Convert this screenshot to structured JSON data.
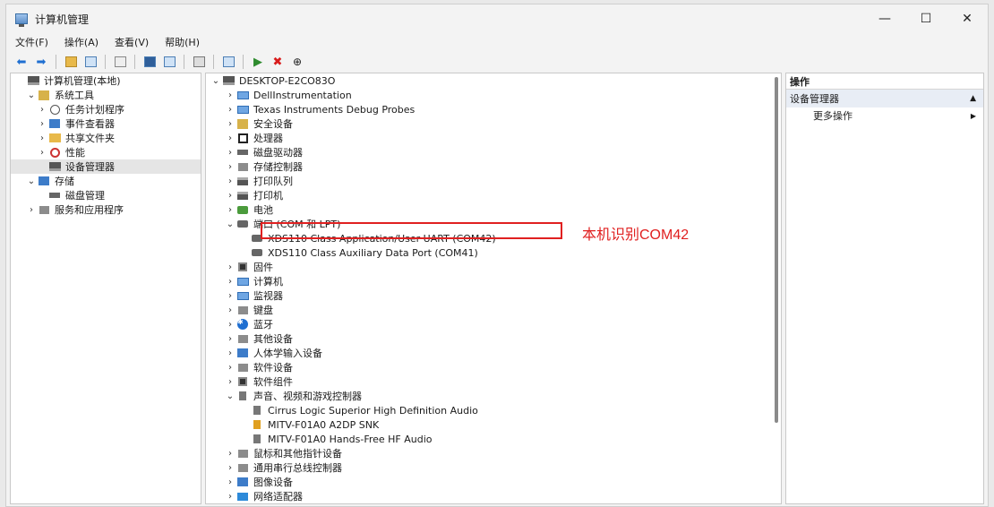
{
  "window": {
    "title": "计算机管理",
    "minimize": "—",
    "maximize": "☐",
    "close": "✕"
  },
  "menu": [
    "文件(F)",
    "操作(A)",
    "查看(V)",
    "帮助(H)"
  ],
  "left_tree": [
    {
      "label": "计算机管理(本地)",
      "indent": 0,
      "expander": "",
      "icon": "computer-mgmt-icon"
    },
    {
      "label": "系统工具",
      "indent": 1,
      "expander": "⌄",
      "icon": "tools-icon"
    },
    {
      "label": "任务计划程序",
      "indent": 2,
      "expander": "›",
      "icon": "clock-icon"
    },
    {
      "label": "事件查看器",
      "indent": 2,
      "expander": "›",
      "icon": "event-viewer-icon"
    },
    {
      "label": "共享文件夹",
      "indent": 2,
      "expander": "›",
      "icon": "shared-folder-icon"
    },
    {
      "label": "性能",
      "indent": 2,
      "expander": "›",
      "icon": "performance-icon"
    },
    {
      "label": "设备管理器",
      "indent": 2,
      "expander": "",
      "icon": "device-manager-icon",
      "selected": true
    },
    {
      "label": "存储",
      "indent": 1,
      "expander": "⌄",
      "icon": "storage-icon"
    },
    {
      "label": "磁盘管理",
      "indent": 2,
      "expander": "",
      "icon": "disk-mgmt-icon"
    },
    {
      "label": "服务和应用程序",
      "indent": 1,
      "expander": "›",
      "icon": "services-icon"
    }
  ],
  "device_tree": [
    {
      "label": "DESKTOP-E2CO83O",
      "indent": 0,
      "expander": "⌄",
      "icon": "computer-icon"
    },
    {
      "label": "DellInstrumentation",
      "indent": 1,
      "expander": "›",
      "icon": "monitor-icon"
    },
    {
      "label": "Texas Instruments Debug Probes",
      "indent": 1,
      "expander": "›",
      "icon": "monitor-icon"
    },
    {
      "label": "安全设备",
      "indent": 1,
      "expander": "›",
      "icon": "security-device-icon"
    },
    {
      "label": "处理器",
      "indent": 1,
      "expander": "›",
      "icon": "processor-icon"
    },
    {
      "label": "磁盘驱动器",
      "indent": 1,
      "expander": "›",
      "icon": "disk-drive-icon"
    },
    {
      "label": "存储控制器",
      "indent": 1,
      "expander": "›",
      "icon": "storage-controller-icon"
    },
    {
      "label": "打印队列",
      "indent": 1,
      "expander": "›",
      "icon": "print-queue-icon"
    },
    {
      "label": "打印机",
      "indent": 1,
      "expander": "›",
      "icon": "printer-icon"
    },
    {
      "label": "电池",
      "indent": 1,
      "expander": "›",
      "icon": "battery-icon"
    },
    {
      "label": "端口 (COM 和 LPT)",
      "indent": 1,
      "expander": "⌄",
      "icon": "port-icon"
    },
    {
      "label": "XDS110 Class Application/User UART (COM42)",
      "indent": 2,
      "expander": "",
      "icon": "port-icon"
    },
    {
      "label": "XDS110 Class Auxiliary Data Port (COM41)",
      "indent": 2,
      "expander": "",
      "icon": "port-icon"
    },
    {
      "label": "固件",
      "indent": 1,
      "expander": "›",
      "icon": "firmware-icon"
    },
    {
      "label": "计算机",
      "indent": 1,
      "expander": "›",
      "icon": "monitor-icon"
    },
    {
      "label": "监视器",
      "indent": 1,
      "expander": "›",
      "icon": "monitor-icon"
    },
    {
      "label": "键盘",
      "indent": 1,
      "expander": "›",
      "icon": "keyboard-icon"
    },
    {
      "label": "蓝牙",
      "indent": 1,
      "expander": "›",
      "icon": "bluetooth-icon"
    },
    {
      "label": "其他设备",
      "indent": 1,
      "expander": "›",
      "icon": "other-device-icon"
    },
    {
      "label": "人体学输入设备",
      "indent": 1,
      "expander": "›",
      "icon": "hid-icon"
    },
    {
      "label": "软件设备",
      "indent": 1,
      "expander": "›",
      "icon": "software-device-icon"
    },
    {
      "label": "软件组件",
      "indent": 1,
      "expander": "›",
      "icon": "software-component-icon"
    },
    {
      "label": "声音、视频和游戏控制器",
      "indent": 1,
      "expander": "⌄",
      "icon": "audio-icon"
    },
    {
      "label": "Cirrus Logic Superior High Definition Audio",
      "indent": 2,
      "expander": "",
      "icon": "audio-icon"
    },
    {
      "label": "MITV-F01A0 A2DP SNK",
      "indent": 2,
      "expander": "",
      "icon": "audio-warning-icon"
    },
    {
      "label": "MITV-F01A0 Hands-Free HF Audio",
      "indent": 2,
      "expander": "",
      "icon": "audio-icon"
    },
    {
      "label": "鼠标和其他指针设备",
      "indent": 1,
      "expander": "›",
      "icon": "mouse-icon"
    },
    {
      "label": "通用串行总线控制器",
      "indent": 1,
      "expander": "›",
      "icon": "usb-icon"
    },
    {
      "label": "图像设备",
      "indent": 1,
      "expander": "›",
      "icon": "imaging-icon"
    },
    {
      "label": "网络适配器",
      "indent": 1,
      "expander": "›",
      "icon": "network-icon"
    }
  ],
  "annotation": "本机识别COM42",
  "actions": {
    "header": "操作",
    "section": "设备管理器",
    "section_arrow": "▲",
    "more": "更多操作",
    "more_arrow": "▶"
  }
}
